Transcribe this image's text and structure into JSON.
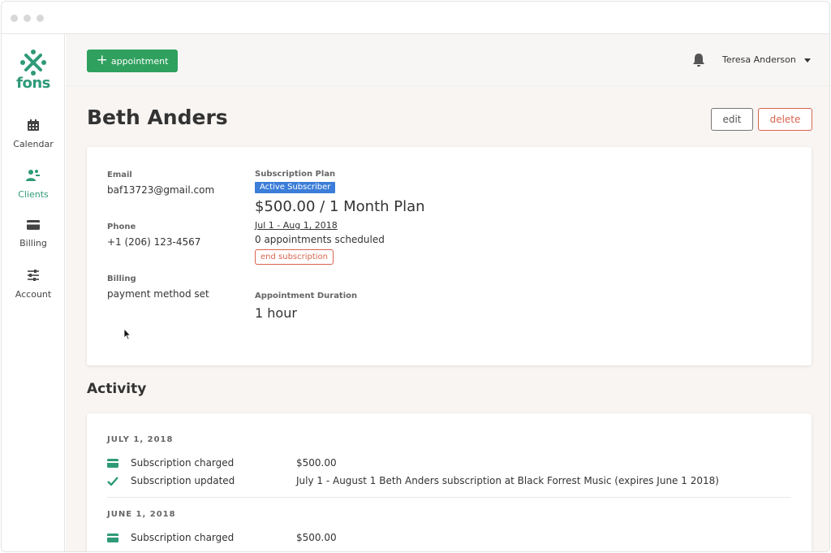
{
  "app": {
    "logo_text": "fons",
    "brand_color": "#2f9a78"
  },
  "sidebar": {
    "items": [
      {
        "label": "Calendar",
        "icon": "calendar-icon"
      },
      {
        "label": "Clients",
        "icon": "clients-icon",
        "active": true
      },
      {
        "label": "Billing",
        "icon": "credit-card-icon"
      },
      {
        "label": "Account",
        "icon": "sliders-icon"
      }
    ]
  },
  "topbar": {
    "new_appointment_label": "appointment",
    "user_name": "Teresa Anderson"
  },
  "client": {
    "name": "Beth Anders",
    "edit_label": "edit",
    "delete_label": "delete",
    "email_label": "Email",
    "email": "baf13723@gmail.com",
    "phone_label": "Phone",
    "phone": "+1 (206) 123-4567",
    "billing_label": "Billing",
    "billing": "payment method set",
    "subscription_label": "Subscription Plan",
    "subscription_status": "Active Subscriber",
    "plan": "$500.00 / 1 Month Plan",
    "plan_dates": "Jul 1 - Aug 1, 2018",
    "appointments_scheduled": "0 appointments scheduled",
    "end_subscription_label": "end subscription",
    "duration_label": "Appointment Duration",
    "duration": "1 hour"
  },
  "activity": {
    "title": "Activity",
    "groups": [
      {
        "date": "JULY 1, 2018",
        "events": [
          {
            "icon": "credit-card-icon",
            "label": "Subscription charged",
            "detail": "$500.00"
          },
          {
            "icon": "check-icon",
            "label": "Subscription updated",
            "detail": "July 1 - August 1 Beth Anders subscription at Black Forrest Music (expires June 1 2018)"
          }
        ]
      },
      {
        "date": "JUNE 1, 2018",
        "events": [
          {
            "icon": "credit-card-icon",
            "label": "Subscription charged",
            "detail": "$500.00"
          }
        ]
      }
    ]
  },
  "colors": {
    "primary_green": "#2fa05e",
    "danger": "#d9644f",
    "badge_blue": "#3b7dd8"
  }
}
